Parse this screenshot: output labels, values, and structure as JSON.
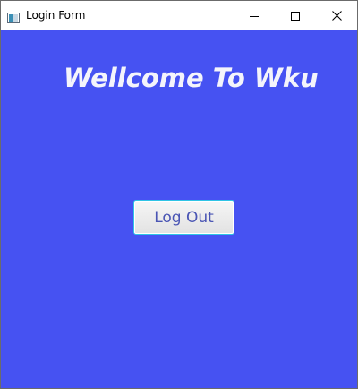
{
  "window": {
    "title": "Login Form",
    "icon": "java-app-icon",
    "controls": [
      "minimize-icon",
      "maximize-icon",
      "close-icon"
    ]
  },
  "main": {
    "heading": "Wellcome To Wku",
    "logout_label": "Log Out"
  },
  "colors": {
    "background": "#4652f2",
    "heading_text": "#f4f4fb",
    "button_text": "#4a55b4",
    "button_focus_border": "#2fc4e6"
  }
}
